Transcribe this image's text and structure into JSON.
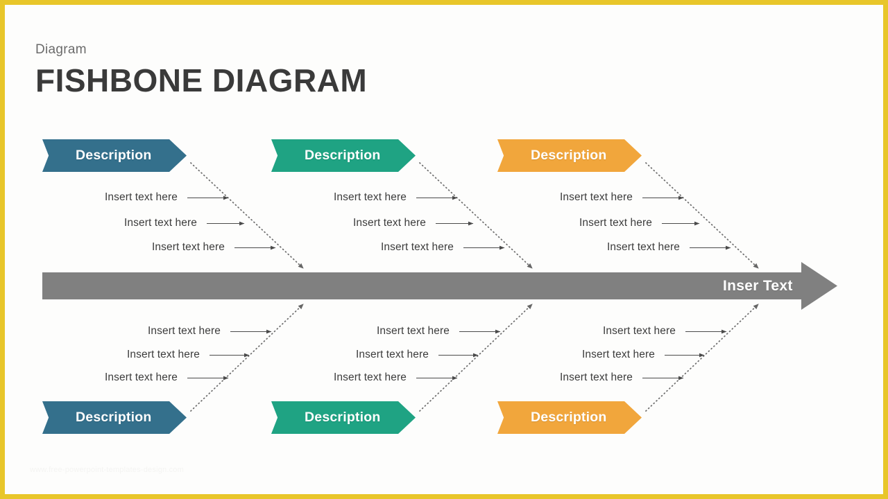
{
  "frame": {
    "border_color": "#e8c62a",
    "canvas_color": "#fdfdfc"
  },
  "header": {
    "kicker": "Diagram",
    "title": "FISHBONE DIAGRAM"
  },
  "spine": {
    "label": "Inser Text",
    "color": "#808080"
  },
  "palette": {
    "blue": "#34708c",
    "green": "#1fa383",
    "orange": "#f1a63c",
    "gray": "#808080",
    "text": "#3c3c3c",
    "title": "#3a3a3a",
    "kicker": "#6b6b6b"
  },
  "bone_text": "Insert text here",
  "top_groups": [
    {
      "id": "top-blue",
      "label": "Description",
      "color": "#34708c",
      "bones": [
        "Insert text here",
        "Insert text here",
        "Insert text here"
      ]
    },
    {
      "id": "top-green",
      "label": "Description",
      "color": "#1fa383",
      "bones": [
        "Insert text here",
        "Insert text here",
        "Insert text here"
      ]
    },
    {
      "id": "top-orange",
      "label": "Description",
      "color": "#f1a63c",
      "bones": [
        "Insert text here",
        "Insert text here",
        "Insert text here"
      ]
    }
  ],
  "bottom_groups": [
    {
      "id": "bottom-blue",
      "label": "Description",
      "color": "#34708c",
      "bones": [
        "Insert text here",
        "Insert text here",
        "Insert text here"
      ]
    },
    {
      "id": "bottom-green",
      "label": "Description",
      "color": "#1fa383",
      "bones": [
        "Insert text here",
        "Insert text here",
        "Insert text here"
      ]
    },
    {
      "id": "bottom-orange",
      "label": "Description",
      "color": "#f1a63c",
      "bones": [
        "Insert text here",
        "Insert text here",
        "Insert text here"
      ]
    }
  ],
  "watermark": "www.free-powerpoint-templates-design.com"
}
